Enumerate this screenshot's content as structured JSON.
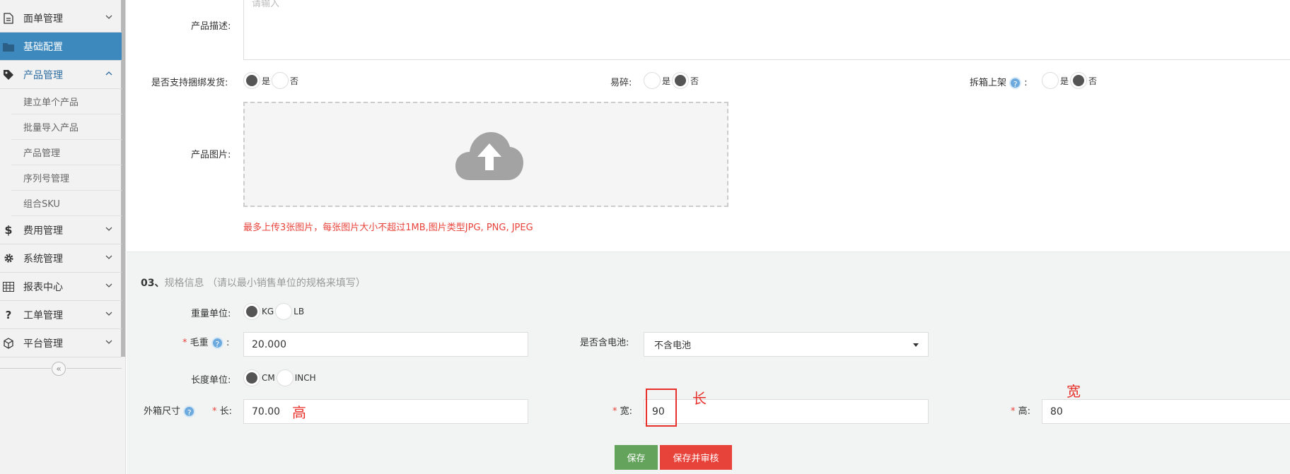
{
  "sidebar": {
    "items": [
      {
        "label": "面单管理",
        "icon": "document-icon"
      },
      {
        "label": "基础配置",
        "icon": "folder-icon"
      },
      {
        "label": "产品管理",
        "icon": "tag-icon"
      },
      {
        "label": "费用管理",
        "icon": "dollar-icon"
      },
      {
        "label": "系统管理",
        "icon": "gear-icon"
      },
      {
        "label": "报表中心",
        "icon": "table-icon"
      },
      {
        "label": "工单管理",
        "icon": "question-icon"
      },
      {
        "label": "平台管理",
        "icon": "cube-icon"
      }
    ],
    "sub_items": [
      "建立单个产品",
      "批量导入产品",
      "产品管理",
      "序列号管理",
      "组合SKU"
    ],
    "collapse_glyph": "«"
  },
  "product": {
    "desc_label": "产品描述:",
    "desc_placeholder": "请输入",
    "bundle_label": "是否支持捆绑发货:",
    "fragile_label": "易碎:",
    "unbox_label": "拆箱上架",
    "unbox_colon": ":",
    "yes": "是",
    "no": "否",
    "image_label": "产品图片:",
    "upload_hint": "最多上传3张图片，每张图片大小不超过1MB,图片类型JPG, PNG, JPEG"
  },
  "spec": {
    "number": "03、",
    "title": "规格信息",
    "subtitle": "（请以最小销售单位的规格来填写）",
    "weight_unit_label": "重量单位:",
    "weight_units": [
      "KG",
      "LB"
    ],
    "gross_weight_label": "毛重",
    "gross_weight_value": "20.000",
    "battery_label": "是否含电池:",
    "battery_value": "不含电池",
    "length_unit_label": "长度单位:",
    "length_units": [
      "CM",
      "INCH"
    ],
    "box_size_label": "外箱尺寸",
    "length_label": "长:",
    "length_value": "70.00",
    "width_label": "宽:",
    "width_value": "90",
    "height_label": "高:",
    "height_value": "80",
    "help_glyph": "?",
    "required_mark": "*",
    "colon": ":"
  },
  "annotations": {
    "gao": "高",
    "chang": "长",
    "kuan": "宽"
  },
  "buttons": {
    "save": "保存",
    "save_audit": "保存并审核"
  },
  "colors": {
    "active_nav": "#3d88bd",
    "save": "#63a35c",
    "save_audit": "#e8433b",
    "annotation": "#e8302b"
  }
}
